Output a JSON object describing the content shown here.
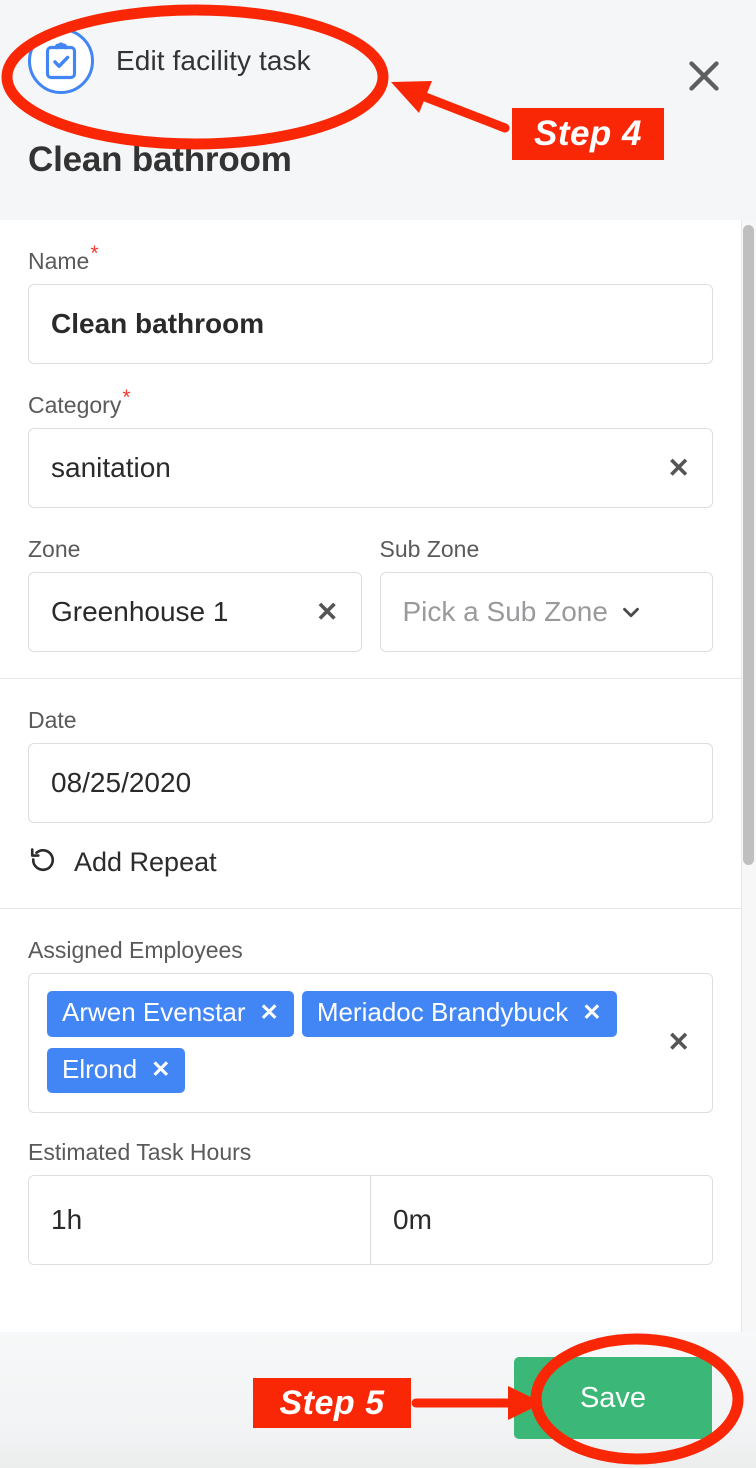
{
  "header": {
    "icon": "clipboard-check-icon",
    "kicker": "Edit facility task",
    "title": "Clean bathroom",
    "close_icon": "close-icon"
  },
  "form": {
    "name": {
      "label": "Name",
      "required_marker": "*",
      "value": "Clean bathroom"
    },
    "category": {
      "label": "Category",
      "required_marker": "*",
      "value": "sanitation",
      "clear_icon": "close-icon"
    },
    "zone": {
      "label": "Zone",
      "value": "Greenhouse 1",
      "clear_icon": "close-icon"
    },
    "sub_zone": {
      "label": "Sub Zone",
      "placeholder": "Pick a Sub Zone",
      "chevron_icon": "chevron-down-icon"
    },
    "date": {
      "label": "Date",
      "value": "08/25/2020"
    },
    "add_repeat": {
      "icon": "rotate-ccw-icon",
      "label": "Add Repeat"
    },
    "assigned_employees": {
      "label": "Assigned Employees",
      "chips": [
        {
          "name": "Arwen Evenstar",
          "remove_icon": "close-icon"
        },
        {
          "name": "Meriadoc Brandybuck",
          "remove_icon": "close-icon"
        },
        {
          "name": "Elrond",
          "remove_icon": "close-icon"
        }
      ],
      "clear_all_icon": "close-icon"
    },
    "estimated_task_hours": {
      "label": "Estimated Task Hours",
      "hours": "1h",
      "minutes": "0m"
    }
  },
  "footer": {
    "save_label": "Save"
  },
  "annotations": {
    "step4": {
      "label": "Step 4",
      "target": "Edit facility task header"
    },
    "step5": {
      "label": "Step 5",
      "target": "Save button"
    },
    "highlight_color": "#fa2706"
  },
  "colors": {
    "accent_blue": "#4285f4",
    "save_green": "#3bb878",
    "required_red": "#f03a2e",
    "header_bg": "#f5f6f8",
    "annotation_red": "#fa2706"
  }
}
